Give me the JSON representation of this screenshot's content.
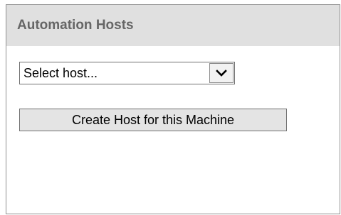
{
  "panel": {
    "title": "Automation Hosts"
  },
  "host_select": {
    "selected_value": "Select host...",
    "icon": "chevron-down-icon"
  },
  "create_host_button": {
    "label": "Create Host for this Machine"
  }
}
